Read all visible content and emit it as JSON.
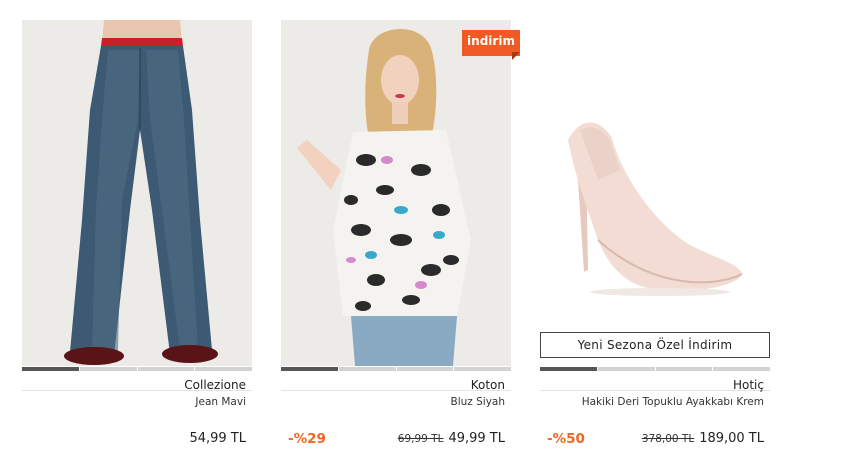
{
  "products": [
    {
      "brand": "Collezione",
      "name": "Jean Mavi",
      "discount": "",
      "old_price": "",
      "price": "54,99 TL",
      "image": "jeans-product-image"
    },
    {
      "brand": "Koton",
      "name": "Bluz Siyah",
      "discount": "-%29",
      "old_price": "69,99 TL",
      "price": "49,99 TL",
      "image": "blouse-product-image",
      "badge": "indirim"
    },
    {
      "brand": "Hotiç",
      "name": "Hakiki Deri Topuklu Ayakkabı Krem",
      "discount": "-%50",
      "old_price": "378,00 TL",
      "price": "189,00 TL",
      "image": "heel-shoe-product-image",
      "promo_label": "Yeni Sezona Özel İndirim"
    }
  ],
  "colors": {
    "accent": "#f26522",
    "badge": "#f05a24"
  }
}
